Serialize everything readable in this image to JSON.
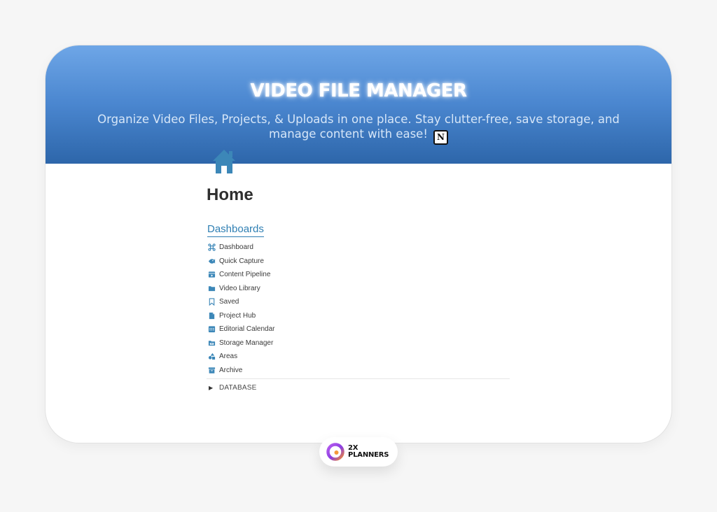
{
  "banner": {
    "title": "VIDEO FILE MANAGER",
    "subtitle": "Organize Video Files, Projects, & Uploads in one place. Stay clutter-free, save storage, and manage content with ease!",
    "subtitle_icon": "notion-icon",
    "gradient_colors": [
      "#6ea6e7",
      "#2d66aa"
    ]
  },
  "page": {
    "icon": "home-icon",
    "title": "Home"
  },
  "section": {
    "heading": "Dashboards",
    "accent_color": "#2f7fb3",
    "items": [
      {
        "label": "Dashboard",
        "icon": "command-icon"
      },
      {
        "label": "Quick Capture",
        "icon": "fish-icon"
      },
      {
        "label": "Content Pipeline",
        "icon": "clapperboard-icon"
      },
      {
        "label": "Video Library",
        "icon": "folder-icon"
      },
      {
        "label": "Saved",
        "icon": "bookmark-icon"
      },
      {
        "label": "Project Hub",
        "icon": "document-icon"
      },
      {
        "label": "Editorial Calendar",
        "icon": "calendar-icon"
      },
      {
        "label": "Storage Manager",
        "icon": "folder-drawer-icon"
      },
      {
        "label": "Areas",
        "icon": "shapes-icon"
      },
      {
        "label": "Archive",
        "icon": "archive-box-icon"
      }
    ]
  },
  "toggle": {
    "label": "DATABASE",
    "icon": "triangle-right-icon"
  },
  "brand": {
    "line1": "2X",
    "line2": "PLANNERS",
    "logo": "ring-logo"
  }
}
